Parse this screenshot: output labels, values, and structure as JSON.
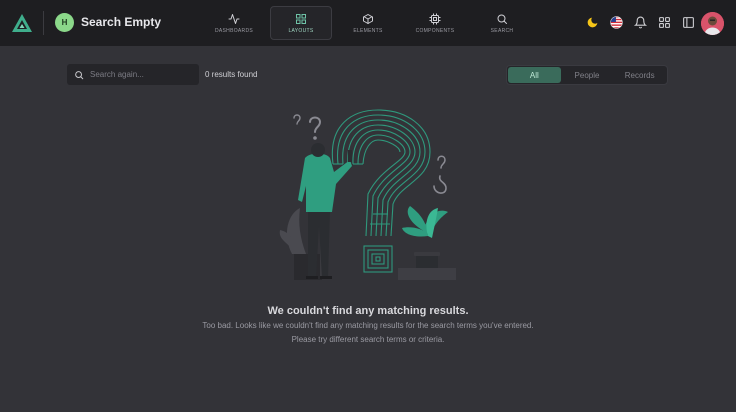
{
  "header": {
    "title": "Search Empty",
    "avatar_initial": "H",
    "nav": [
      {
        "label": "DASHBOARDS",
        "icon": "activity-icon"
      },
      {
        "label": "LAYOUTS",
        "icon": "grid-icon",
        "active": true
      },
      {
        "label": "ELEMENTS",
        "icon": "box-icon"
      },
      {
        "label": "COMPONENTS",
        "icon": "cpu-icon"
      },
      {
        "label": "SEARCH",
        "icon": "search-icon"
      }
    ],
    "right_icons": [
      "moon-icon",
      "us-flag-icon",
      "bell-icon",
      "apps-grid-icon",
      "sidebar-panel-icon",
      "user-avatar"
    ]
  },
  "search": {
    "placeholder": "Search again...",
    "value": "",
    "results_text": "0 results found"
  },
  "filters": {
    "tabs": [
      "All",
      "People",
      "Records"
    ],
    "active": "All"
  },
  "empty_state": {
    "title": "We couldn't find any matching results.",
    "line1": "Too bad. Looks like we couldn't find any matching results for the search terms you've entered.",
    "line2": "Please try different search terms or criteria."
  },
  "colors": {
    "background": "#333338",
    "navbar": "#1e1e21",
    "accent": "#3a6b5b",
    "illustration_green": "#2f9e80"
  }
}
